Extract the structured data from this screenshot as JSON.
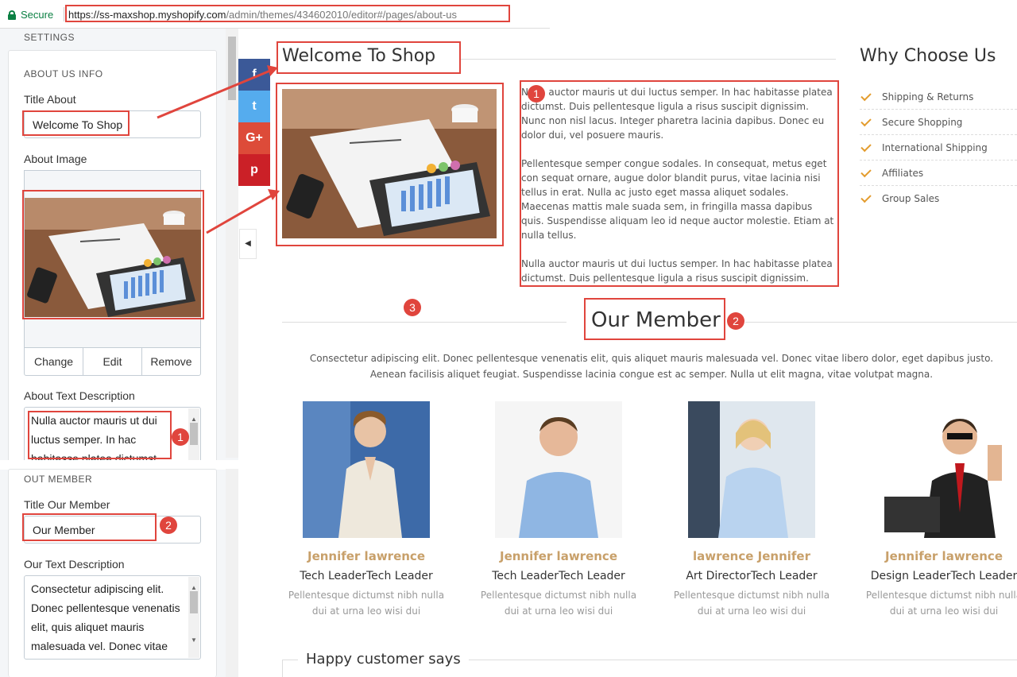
{
  "browser": {
    "secure_label": "Secure",
    "url_host": "https://ss-maxshop.myshopify.com",
    "url_path": "/admin/themes/434602010/editor#/pages/about-us"
  },
  "settings_panel": {
    "heading": "SETTINGS",
    "about_section": {
      "heading": "ABOUT US INFO",
      "title_label": "Title About",
      "title_value": "Welcome To Shop",
      "image_label": "About Image",
      "image_buttons": [
        "Change",
        "Edit",
        "Remove"
      ],
      "text_label": "About Text Description",
      "text_value": "Nulla auctor mauris ut dui luctus semper. In hac habitasse platea dictumst"
    },
    "member_section": {
      "heading": "OUT MEMBER",
      "title_label": "Title Our Member",
      "title_value": "Our Member",
      "text_label": "Our Text Description",
      "text_value": "Consectetur adipiscing elit. Donec pellentesque venenatis elit, quis aliquet mauris malesuada vel. Donec vitae"
    }
  },
  "social_buttons": [
    {
      "icon": "facebook-icon",
      "glyph": "f",
      "color": "#3b5998"
    },
    {
      "icon": "twitter-icon",
      "glyph": "t",
      "color": "#55acee"
    },
    {
      "icon": "google-plus-icon",
      "glyph": "G+",
      "color": "#dd4b39"
    },
    {
      "icon": "pinterest-icon",
      "glyph": "p",
      "color": "#cb2027"
    }
  ],
  "preview": {
    "welcome_title": "Welcome To Shop",
    "about_paragraphs": [
      "Nulla auctor mauris ut dui luctus semper. In hac habitasse platea dictumst. Duis pellentesque ligula a risus suscipit dignissim. Nunc non nisl lacus. Integer pharetra lacinia dapibus. Donec eu dolor dui, vel posuere mauris.",
      "Pellentesque semper congue sodales. In consequat, metus eget con sequat ornare, augue dolor blandit purus, vitae lacinia nisi tellus in erat. Nulla ac justo eget massa aliquet sodales. Maecenas mattis male suada sem, in fringilla massa dapibus quis. Suspendisse aliquam leo id neque auctor molestie. Etiam at nulla tellus.",
      "Nulla auctor mauris ut dui luctus semper. In hac habitasse platea dictumst. Duis pellentesque ligula a risus suscipit dignissim."
    ],
    "why_title": "Why Choose Us",
    "why_items": [
      "Shipping & Returns",
      "Secure Shopping",
      "International Shipping",
      "Affiliates",
      "Group Sales"
    ],
    "member_title": "Our Member",
    "member_intro_1": "Consectetur adipiscing elit. Donec pellentesque venenatis elit, quis aliquet mauris malesuada vel. Donec vitae libero dolor, eget dapibus justo.",
    "member_intro_2": "Aenean facilisis aliquet feugiat. Suspendisse lacinia congue est ac semper. Nulla ut elit magna, vitae volutpat magna.",
    "members": [
      {
        "name": "Jennifer lawrence",
        "role": "Tech LeaderTech Leader",
        "desc": "Pellentesque dictumst nibh nulla dui at urna leo wisi dui"
      },
      {
        "name": "Jennifer lawrence",
        "role": "Tech LeaderTech Leader",
        "desc": "Pellentesque dictumst nibh nulla dui at urna leo wisi dui"
      },
      {
        "name": "lawrence Jennifer",
        "role": "Art DirectorTech Leader",
        "desc": "Pellentesque dictumst nibh nulla dui at urna leo wisi dui"
      },
      {
        "name": "Jennifer lawrence",
        "role": "Design LeaderTech Leader",
        "desc": "Pellentesque dictumst nibh nulla dui at urna leo wisi dui"
      }
    ],
    "testimonial_title": "Happy customer says"
  },
  "annotations": {
    "one": "1",
    "two": "2",
    "three": "3"
  },
  "colors": {
    "accent_red": "#e0453d",
    "member_name": "#c8a06a",
    "check": "#e39c2e"
  }
}
